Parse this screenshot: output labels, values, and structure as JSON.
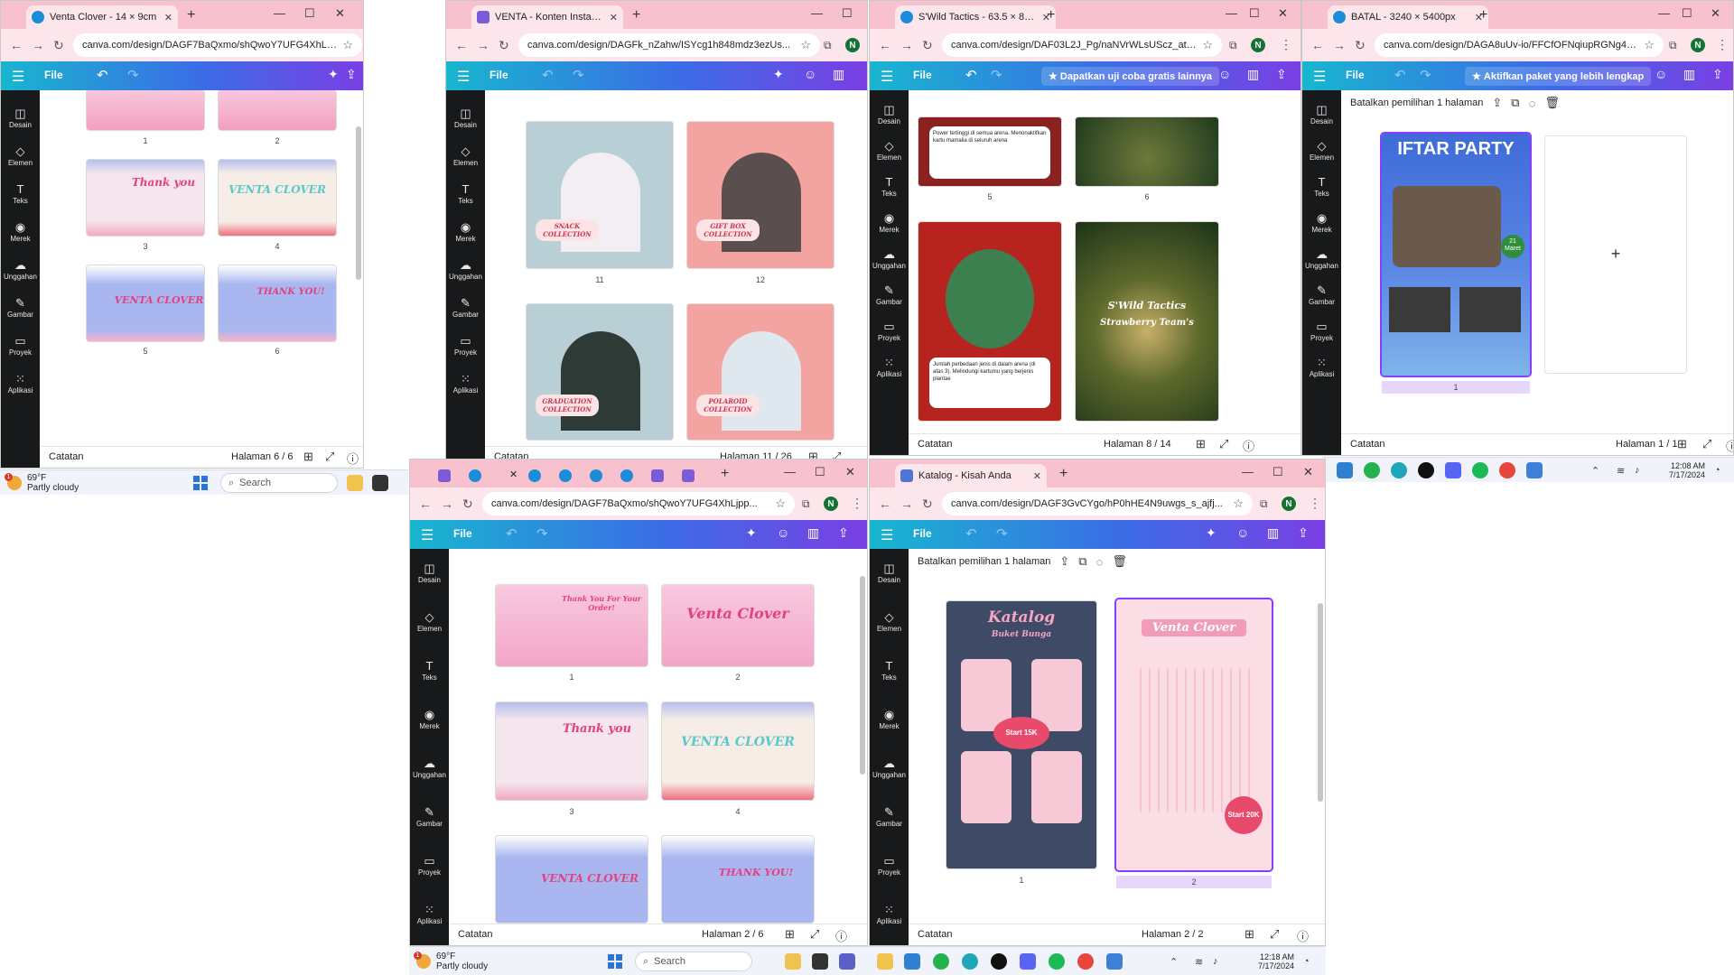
{
  "colors": {
    "canva_gradient_start": "#18b6cf",
    "canva_gradient_end": "#7a3fe4",
    "tab_strip": "#f7c1cd",
    "rail": "#18191b"
  },
  "rail_items": [
    "Desain",
    "Elemen",
    "Teks",
    "Merek",
    "Unggahan",
    "Gambar",
    "Proyek",
    "Aplikasi"
  ],
  "common": {
    "file_label": "File",
    "notes_label": "Catatan",
    "help_label": "?"
  },
  "win1": {
    "tab_title": "Venta Clover - 14 × 9cm",
    "url": "canva.com/design/DAGF7BaQxmo/shQwoY7UFG4XhLjpp...",
    "page_label": "Halaman 6 / 6",
    "page_numbers": [
      "1",
      "2",
      "3",
      "4",
      "5",
      "6"
    ],
    "thumb_texts": {
      "p3": "Thank you",
      "p4": "VENTA CLOVER",
      "p5": "VENTA CLOVER",
      "p6": "THANK YOU!"
    }
  },
  "win2": {
    "tab_title": "VENTA - Konten Instagram",
    "url": "canva.com/design/DAGFk_nZahw/ISYcg1h848mdz3ezUs...",
    "page_label": "Halaman 11 / 26",
    "page_numbers": [
      "11",
      "12"
    ],
    "thumb_texts": {
      "p11": "SNACK COLLECTION",
      "p12": "GIFT BOX COLLECTION",
      "p13": "GRADUATION COLLECTION",
      "p14": "POLAROID COLLECTION"
    }
  },
  "win3": {
    "tab_title": "S'Wild Tactics - 63.5 × 88.9mm",
    "url": "canva.com/design/DAF03L2J_Pg/naNVrWLsUScz_at0Qoq...",
    "promo": "Dapatkan uji coba gratis lainnya",
    "page_label": "Halaman 8 / 14",
    "page_numbers": [
      "5",
      "6"
    ],
    "card5_text": "Power tertinggi di semua arena. Menonaktifkan kartu mamalia di seluruh arena",
    "card7_text": "Jumlah perbedaan jenis di dalam arena (di atas 3). Melindungi kartumu yang berjenis plantae",
    "card8_title": "S'Wild Tactics",
    "card8_sub": "Strawberry Team's"
  },
  "win4": {
    "tab_title": "BATAL - 3240 × 5400px",
    "url": "canva.com/design/DAGA8uUv-io/FFCfOFNqiupRGNg4Q...",
    "promo": "Aktifkan paket yang lebih lengkap",
    "selection_label": "Batalkan pemilihan 1 halaman",
    "page_label": "Halaman 1 / 1",
    "page_number": "1",
    "poster_title": "IFTAR PARTY",
    "poster_date": "21 Maret",
    "add_page": "+"
  },
  "win5": {
    "url": "canva.com/design/DAGF7BaQxmo/shQwoY7UFG4XhLjpp...",
    "page_label": "Halaman 2 / 6",
    "page_numbers": [
      "1",
      "2",
      "3",
      "4"
    ],
    "thumb_texts": {
      "p1": "Thank You For Your Order!",
      "p2": "Venta Clover",
      "p3": "Thank you",
      "p4": "VENTA CLOVER",
      "p5": "VENTA CLOVER",
      "p6": "THANK YOU!"
    }
  },
  "win6": {
    "tab_title": "Katalog - Kisah Anda",
    "url": "canva.com/design/DAGF3GvCYgo/hP0hHE4N9uwgs_s_ajfj...",
    "selection_label": "Batalkan pemilihan 1 halaman",
    "page_label": "Halaman 2 / 2",
    "page_numbers": [
      "1",
      "2"
    ],
    "p1_title": "Katalog",
    "p1_subtitle": "Buket Bunga",
    "p1_badge": "Start 15K",
    "p2_title": "Venta Clover",
    "p2_badge": "Start 20K"
  },
  "taskbar": {
    "weather_temp": "69°F",
    "weather_desc": "Partly cloudy",
    "weather_badge": "1",
    "search_label": "Search",
    "time": "12:08 AM",
    "date": "7/17/2024",
    "time_bottom": "12:18 AM",
    "date_bottom": "7/17/2024"
  }
}
